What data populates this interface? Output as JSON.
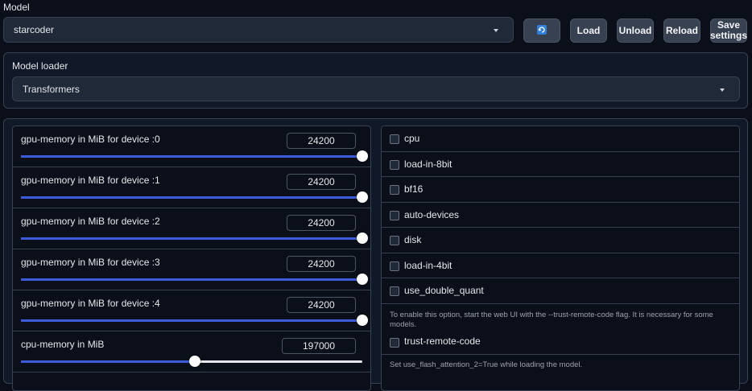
{
  "model": {
    "label": "Model",
    "selected": "starcoder",
    "refresh_icon": "refresh-icon",
    "buttons": {
      "load": "Load",
      "unload": "Unload",
      "reload": "Reload",
      "save_line1": "Save",
      "save_line2": "settings"
    }
  },
  "loader": {
    "label": "Model loader",
    "selected": "Transformers"
  },
  "sliders": [
    {
      "label": "gpu-memory in MiB for device :0",
      "value": "24200",
      "fraction": 1.0
    },
    {
      "label": "gpu-memory in MiB for device :1",
      "value": "24200",
      "fraction": 1.0
    },
    {
      "label": "gpu-memory in MiB for device :2",
      "value": "24200",
      "fraction": 1.0
    },
    {
      "label": "gpu-memory in MiB for device :3",
      "value": "24200",
      "fraction": 1.0
    },
    {
      "label": "gpu-memory in MiB for device :4",
      "value": "24200",
      "fraction": 1.0
    },
    {
      "label": "cpu-memory in MiB",
      "value": "197000",
      "fraction": 0.51
    }
  ],
  "checkboxes": [
    {
      "label": "cpu",
      "checked": false
    },
    {
      "label": "load-in-8bit",
      "checked": false
    },
    {
      "label": "bf16",
      "checked": false
    },
    {
      "label": "auto-devices",
      "checked": false
    },
    {
      "label": "disk",
      "checked": false
    },
    {
      "label": "load-in-4bit",
      "checked": false
    },
    {
      "label": "use_double_quant",
      "checked": false
    }
  ],
  "trust": {
    "info": "To enable this option, start the web UI with the --trust-remote-code flag. It is necessary for some models.",
    "label": "trust-remote-code",
    "checked": false
  },
  "flash_info": "Set use_flash_attention_2=True while loading the model.",
  "colors": {
    "accent": "#3b5bdb",
    "background": "#0b0f19",
    "panel": "#111827",
    "border": "#374151"
  }
}
